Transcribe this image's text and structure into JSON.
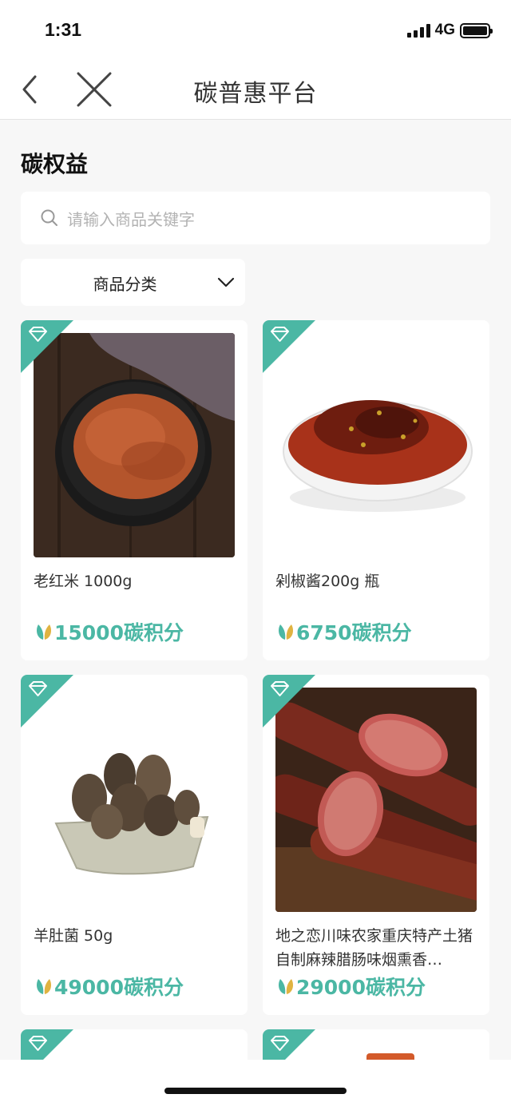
{
  "status": {
    "time": "1:31",
    "network": "4G"
  },
  "nav": {
    "title": "碳普惠平台"
  },
  "section": {
    "title": "碳权益"
  },
  "search": {
    "placeholder": "请输入商品关键字"
  },
  "filter": {
    "category_label": "商品分类"
  },
  "colors": {
    "accent": "#4bb7a4",
    "leaf_gold": "#e0b341"
  },
  "products": [
    {
      "name": "老红米 1000g",
      "price": "15000碳积分",
      "image": "red-rice-bowl"
    },
    {
      "name": "剁椒酱200g 瓶",
      "price": "6750碳积分",
      "image": "chili-sauce-bowl"
    },
    {
      "name": "羊肚菌 50g",
      "price": "49000碳积分",
      "image": "morel-mushrooms"
    },
    {
      "name": "地之恋川味农家重庆特产土猪自制麻辣腊肠味烟熏香…",
      "price": "29000碳积分",
      "image": "spicy-sausages"
    }
  ]
}
